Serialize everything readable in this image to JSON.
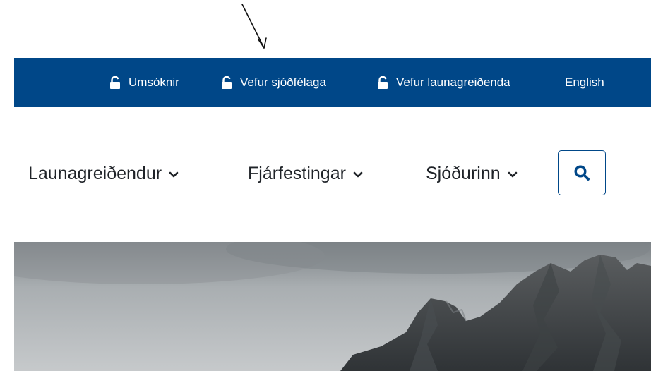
{
  "utility_bar": {
    "items": [
      {
        "label": "Umsóknir",
        "icon": "lock-open-icon"
      },
      {
        "label": "Vefur sjóðfélaga",
        "icon": "lock-open-icon"
      },
      {
        "label": "Vefur launagreiðenda",
        "icon": "lock-open-icon"
      },
      {
        "label": "English"
      }
    ],
    "background": "#004788",
    "text_color": "#ffffff"
  },
  "main_nav": {
    "items": [
      {
        "label": "Launagreiðendur",
        "icon": "chevron-down-icon"
      },
      {
        "label": "Fjárfestingar",
        "icon": "chevron-down-icon"
      },
      {
        "label": "Sjóðurinn",
        "icon": "chevron-down-icon"
      }
    ],
    "search_icon": "search-icon",
    "accent": "#004788"
  },
  "hero": {
    "image": "mountain-landscape"
  }
}
